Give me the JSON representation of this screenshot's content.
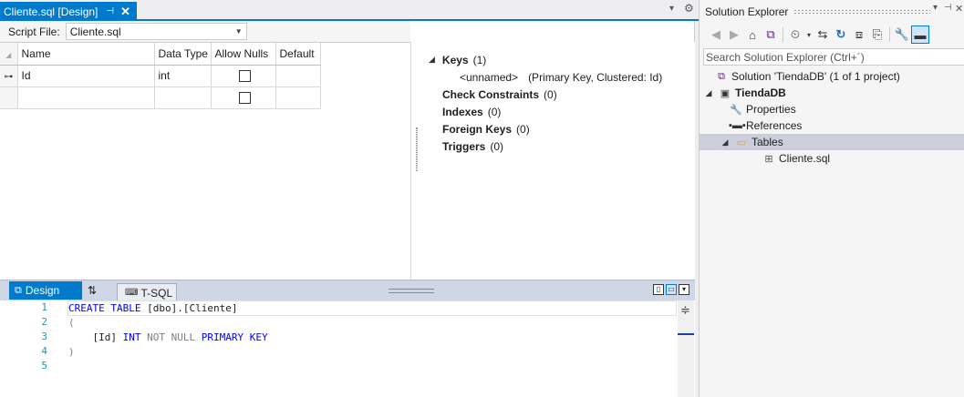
{
  "doc_tab": {
    "title": "Cliente.sql [Design]",
    "pin_glyph": "←∔",
    "close_glyph": "✕"
  },
  "script_file": {
    "label": "Script File:",
    "value": "Cliente.sql"
  },
  "grid": {
    "columns": [
      "Name",
      "Data Type",
      "Allow Nulls",
      "Default"
    ],
    "rows": [
      {
        "name": "Id",
        "data_type": "int",
        "allow_nulls": false,
        "default": "",
        "primary_key": true
      },
      {
        "name": "",
        "data_type": "",
        "allow_nulls": false,
        "default": "",
        "primary_key": false
      }
    ]
  },
  "properties": {
    "keys_label": "Keys",
    "keys_count": "(1)",
    "key_name": "<unnamed>",
    "key_detail": "(Primary Key, Clustered: Id)",
    "check_label": "Check Constraints",
    "check_count": "(0)",
    "indexes_label": "Indexes",
    "indexes_count": "(0)",
    "fk_label": "Foreign Keys",
    "fk_count": "(0)",
    "triggers_label": "Triggers",
    "triggers_count": "(0)"
  },
  "pane_tabs": {
    "design": "Design",
    "tsql": "T-SQL"
  },
  "editor": {
    "line_numbers": [
      "1",
      "2",
      "3",
      "4",
      "5"
    ],
    "line1": {
      "kw": "CREATE TABLE",
      "rest": " [dbo].[Cliente]"
    },
    "line2": "(",
    "line3": {
      "indent": "    ",
      "col": "[Id]",
      "type": "INT",
      "notnull": "NOT NULL",
      "pk": "PRIMARY KEY"
    },
    "line4": ")"
  },
  "solution_explorer": {
    "title": "Solution Explorer",
    "search_placeholder": "Search Solution Explorer (Ctrl+´)",
    "solution": "Solution 'TiendaDB' (1 of 1 project)",
    "project": "TiendaDB",
    "properties": "Properties",
    "references": "References",
    "tables": "Tables",
    "file": "Cliente.sql"
  },
  "colors": {
    "accent": "#007acc",
    "selection": "#cccedb",
    "keyword": "#0000ff",
    "line_number": "#2b91af"
  }
}
